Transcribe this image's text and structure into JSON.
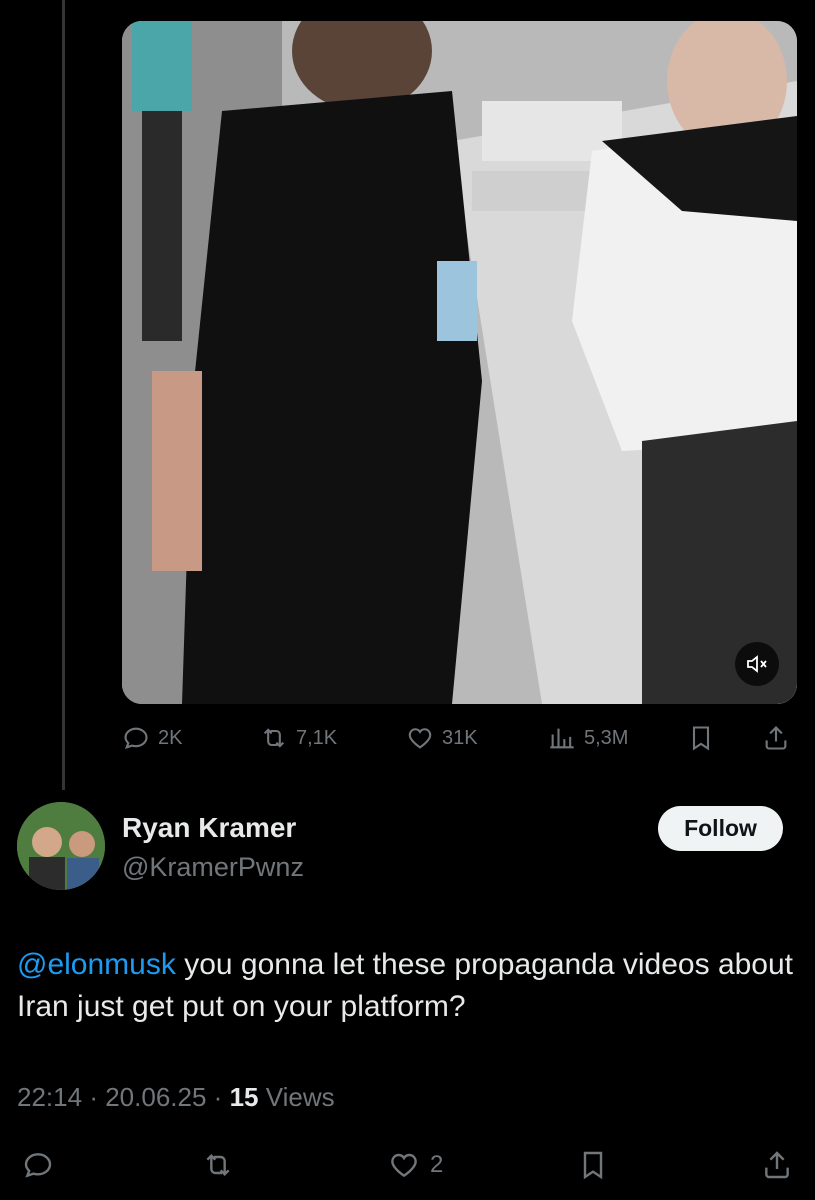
{
  "embedded_tweet": {
    "video": {
      "muted": true
    },
    "actions": {
      "replies": "2K",
      "reposts": "7,1K",
      "likes": "31K",
      "views": "5,3M"
    }
  },
  "tweet": {
    "author": {
      "display_name": "Ryan Kramer",
      "handle": "@KramerPwnz"
    },
    "follow_label": "Follow",
    "mention": "@elonmusk",
    "text": " you gonna let these propaganda videos about Iran just get put on your platform?",
    "time": "22:14",
    "date": "20.06.25",
    "separator": "·",
    "views_count": "15",
    "views_label": "Views"
  },
  "bottom_actions": {
    "likes": "2"
  },
  "colors": {
    "background": "#000000",
    "text_primary": "#e7e9ea",
    "text_secondary": "#71767b",
    "accent": "#1d9bf0"
  },
  "icons": [
    "reply-icon",
    "repost-icon",
    "like-icon",
    "views-icon",
    "bookmark-icon",
    "share-icon",
    "mute-icon"
  ]
}
